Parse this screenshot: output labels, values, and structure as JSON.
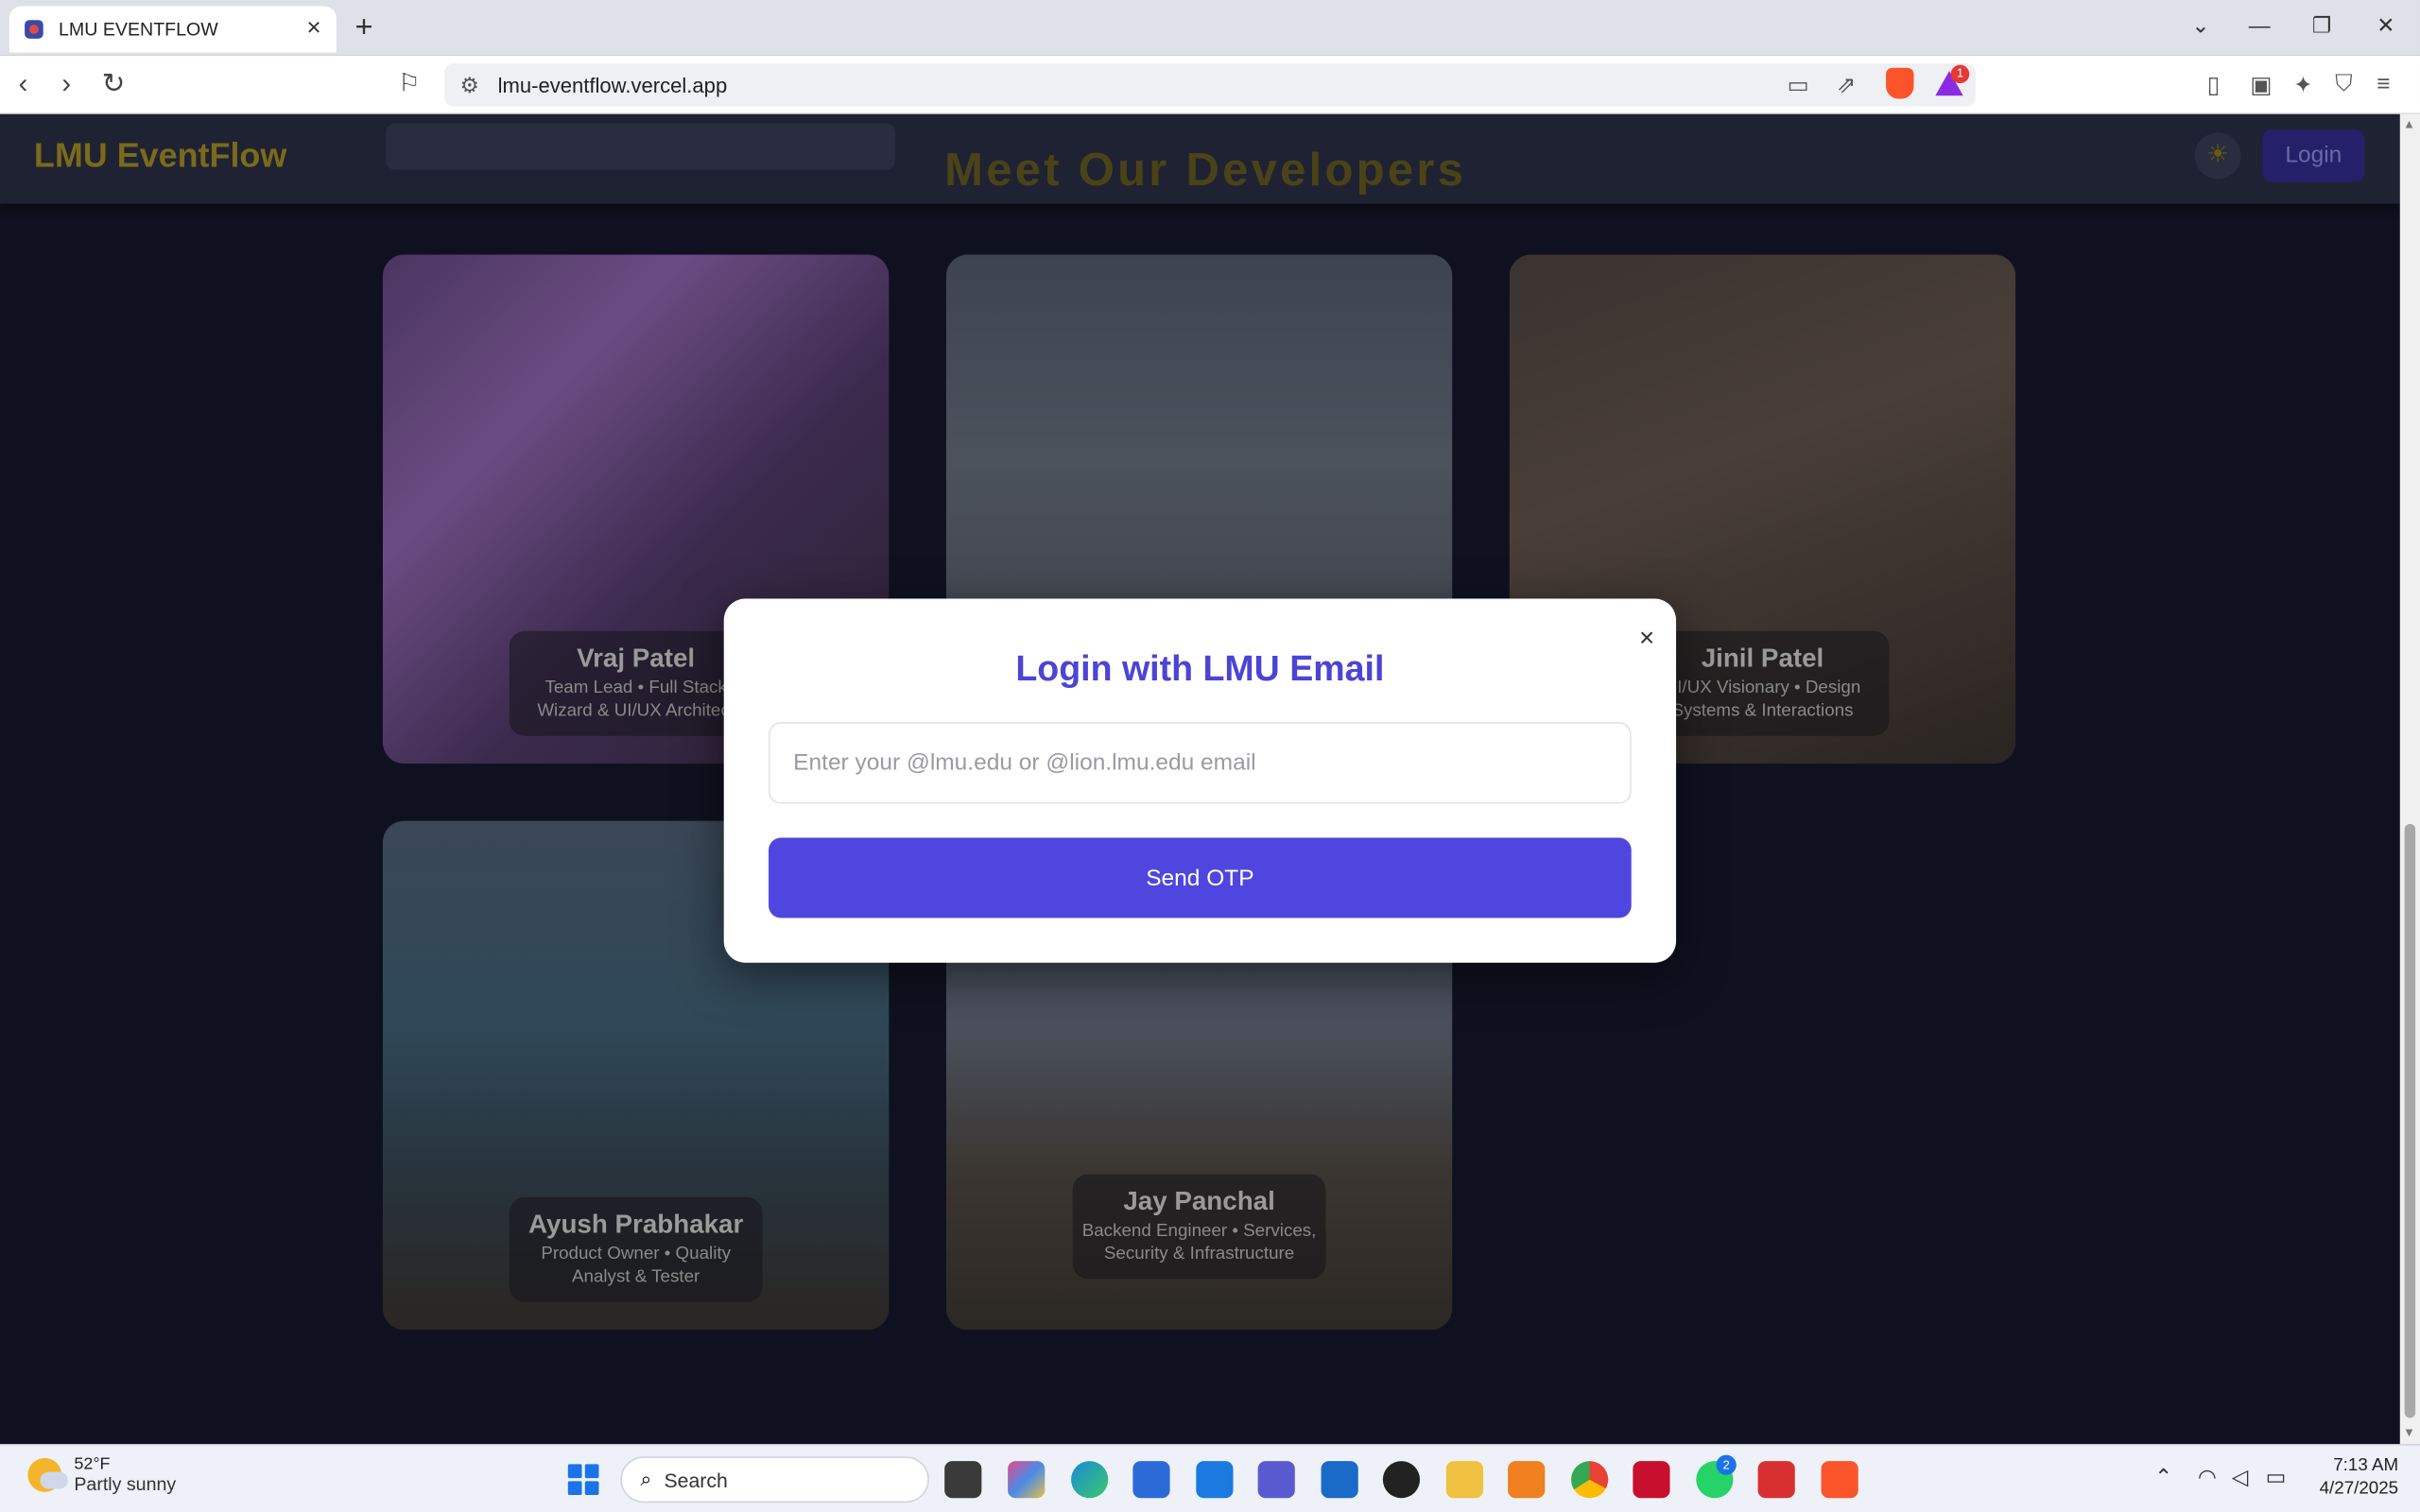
{
  "browser": {
    "tab_title": "LMU EVENTFLOW",
    "url": "lmu-eventflow.vercel.app",
    "new_tab": "+",
    "tab_close": "×",
    "window_controls": [
      "⌄",
      "—",
      "❐",
      "✕"
    ],
    "notification_count": "1"
  },
  "site": {
    "brand": "LMU EventFlow",
    "page_heading": "Meet Our Developers",
    "login_label": "Login",
    "theme_icon": "☀"
  },
  "team": [
    {
      "name": "Vraj Patel",
      "role": "Team Lead • Full Stack Wizard & UI/UX Architect"
    },
    {
      "name": "",
      "role": ""
    },
    {
      "name": "Jinil Patel",
      "role": "UI/UX Visionary • Design Systems & Interactions"
    },
    {
      "name": "Ayush Prabhakar",
      "role": "Product Owner • Quality Analyst & Tester"
    },
    {
      "name": "Jay Panchal",
      "role": "Backend Engineer • Services, Security & Infrastructure"
    }
  ],
  "modal": {
    "title": "Login with LMU Email",
    "close": "×",
    "email_placeholder": "Enter your @lmu.edu or @lion.lmu.edu email",
    "email_value": "",
    "submit_label": "Send OTP"
  },
  "taskbar": {
    "temp": "52°F",
    "condition": "Partly sunny",
    "search_label": "Search",
    "whatsapp_badge": "2",
    "time": "7:13 AM",
    "date": "4/27/2025"
  },
  "colors": {
    "accent": "#4f46e0",
    "modal_title": "#4c44d4",
    "page_bg": "#0f1120"
  }
}
